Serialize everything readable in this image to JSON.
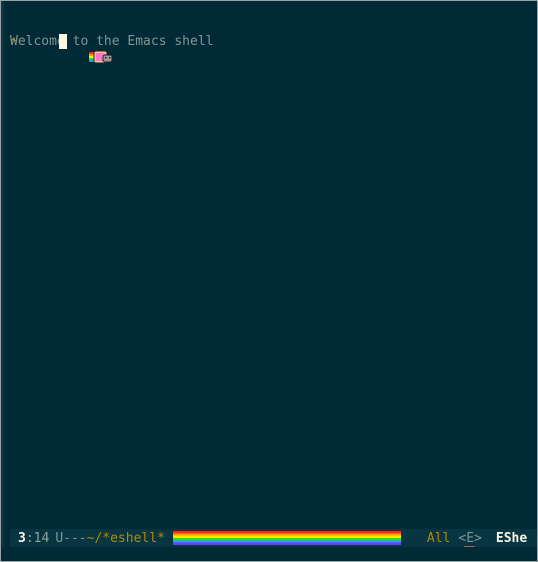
{
  "buffer": {
    "welcome_text": "Welcome to the Emacs shell",
    "prompt_symbol": "~"
  },
  "modeline": {
    "line": "3",
    "column": ":14",
    "state": "U---",
    "buffer_name": "~/*eshell*",
    "position": "All",
    "evil_tag": "<E>",
    "major_mode": "EShe"
  },
  "icons": {
    "prompt_icon": "nyan-cat-icon",
    "modeline_icon": "nyan-cat-icon"
  },
  "colors": {
    "background": "#002b36",
    "modeline_bg": "#073642",
    "accent": "#b58900",
    "text": "#839496",
    "cursor": "#fdf6e3"
  }
}
